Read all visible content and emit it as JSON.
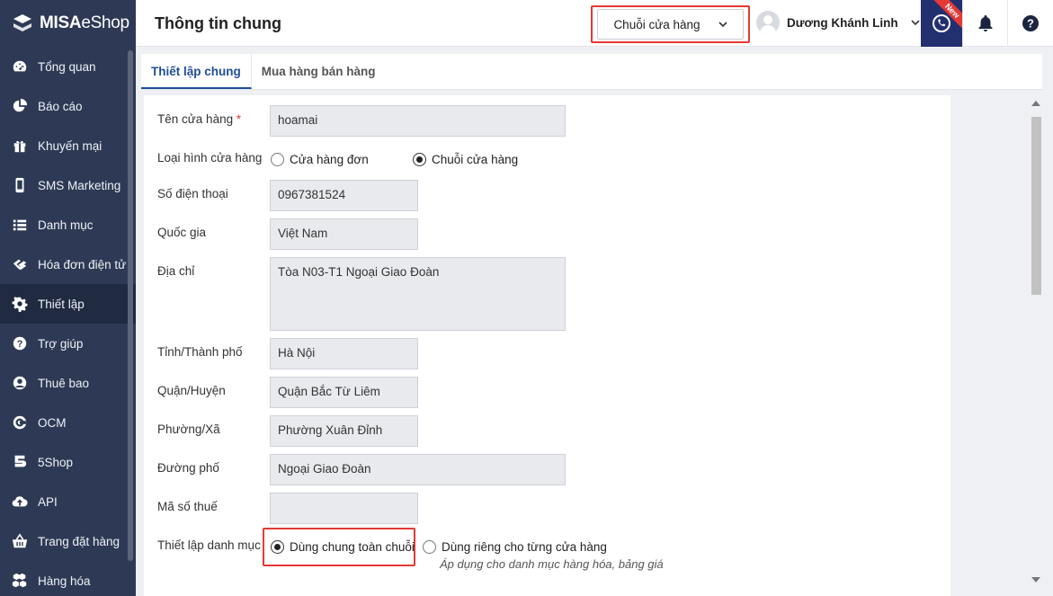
{
  "app": {
    "brand_bold": "MISA",
    "brand_light": "eShop"
  },
  "sidebar": {
    "items": [
      {
        "label": "Tổng quan",
        "icon": "dashboard-icon"
      },
      {
        "label": "Báo cáo",
        "icon": "pie-chart-icon"
      },
      {
        "label": "Khuyến mại",
        "icon": "gift-icon"
      },
      {
        "label": "SMS Marketing",
        "icon": "mobile-icon"
      },
      {
        "label": "Danh mục",
        "icon": "list-icon"
      },
      {
        "label": "Hóa đơn điện tử",
        "icon": "invoice-icon"
      },
      {
        "label": "Thiết lập",
        "icon": "gear-icon",
        "active": true
      },
      {
        "label": "Trợ giúp",
        "icon": "question-icon"
      },
      {
        "label": "Thuê bao",
        "icon": "user-icon"
      },
      {
        "label": "OCM",
        "icon": "ocm-icon"
      },
      {
        "label": "5Shop",
        "icon": "5shop-icon"
      },
      {
        "label": "API",
        "icon": "cloud-upload-icon"
      },
      {
        "label": "Trang đặt hàng",
        "icon": "basket-icon"
      },
      {
        "label": "Hàng hóa",
        "icon": "boxes-icon"
      }
    ]
  },
  "header": {
    "title": "Thông tin chung",
    "store_select": "Chuỗi cửa hàng",
    "user_name": "Dương Khánh Linh",
    "new_badge": "New"
  },
  "tabs": [
    {
      "label": "Thiết lập chung",
      "active": true
    },
    {
      "label": "Mua hàng bán hàng",
      "active": false
    }
  ],
  "form": {
    "store_name": {
      "label": "Tên cửa hàng",
      "required": "*",
      "value": "hoamai"
    },
    "store_type": {
      "label": "Loại hình cửa hàng",
      "options": [
        "Cửa hàng đơn",
        "Chuỗi cửa hàng"
      ],
      "selected": "Chuỗi cửa hàng"
    },
    "phone": {
      "label": "Số điện thoại",
      "value": "0967381524"
    },
    "country": {
      "label": "Quốc gia",
      "value": "Việt Nam"
    },
    "address": {
      "label": "Địa chỉ",
      "value": "Tòa N03-T1 Ngoại Giao Đoàn"
    },
    "province": {
      "label": "Tỉnh/Thành phố",
      "value": "Hà Nội"
    },
    "district": {
      "label": "Quận/Huyện",
      "value": "Quận Bắc Từ Liêm"
    },
    "ward": {
      "label": "Phường/Xã",
      "value": "Phường Xuân Đỉnh"
    },
    "street": {
      "label": "Đường phố",
      "value": "Ngoại Giao Đoàn"
    },
    "tax_code": {
      "label": "Mã số thuế",
      "value": ""
    },
    "category_setting": {
      "label": "Thiết lập danh mục",
      "options": [
        "Dùng chung toàn chuỗi",
        "Dùng riêng cho từng cửa hàng"
      ],
      "selected": "Dùng chung toàn chuỗi",
      "note": "Áp dụng cho danh mục hàng hóa, bảng giá"
    }
  },
  "colors": {
    "sidebar": "#2e3a55",
    "accent": "#1f4e98",
    "highlight": "#e53935",
    "phone_button": "#233070"
  }
}
